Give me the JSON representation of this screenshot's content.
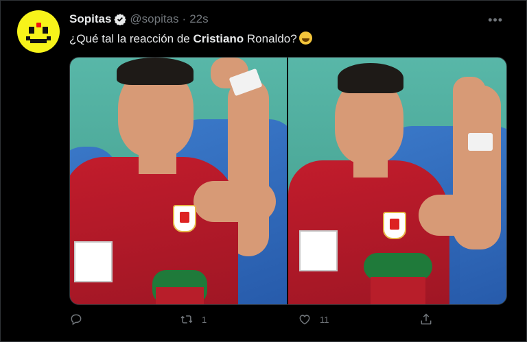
{
  "tweet": {
    "author_name": "Sopitas",
    "handle": "@sopitas",
    "separator": "·",
    "time": "22s",
    "text_before": "¿Qué tal la reacción de ",
    "text_bold": "Cristiano",
    "text_after": " Ronaldo?",
    "more_label": "•••"
  },
  "media": {
    "images": [
      {
        "name": "photo-left"
      },
      {
        "name": "photo-right"
      }
    ]
  },
  "actions": {
    "reply_count": "",
    "retweet_count": "1",
    "like_count": "11",
    "share_count": ""
  },
  "colors": {
    "background": "#000000",
    "text": "#e7e9ea",
    "muted": "#71767b",
    "avatar_yellow": "#f7f31a"
  },
  "icons": [
    "verified-badge-icon",
    "more-icon",
    "reply-icon",
    "retweet-icon",
    "like-icon",
    "share-icon",
    "grinning-emoji-icon"
  ]
}
